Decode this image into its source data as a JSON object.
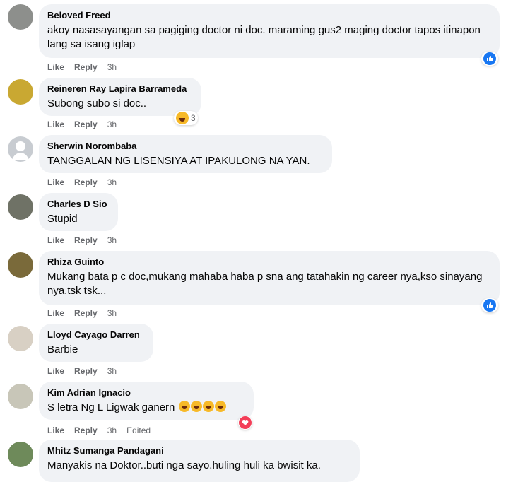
{
  "actions": {
    "like": "Like",
    "reply": "Reply",
    "edited": "Edited"
  },
  "comments": [
    {
      "name": "Beloved Freed",
      "text": "akoy nasasayangan sa pagiging doctor ni doc. maraming gus2 maging doctor tapos itinapon lang sa isang iglap",
      "time": "3h",
      "reaction": "like-icon"
    },
    {
      "name": "Reineren Ray Lapira Barrameda",
      "text": "Subong subo si doc..",
      "time": "3h",
      "reaction": "haha-icon",
      "reaction_count": "3"
    },
    {
      "name": "Sherwin Norombaba",
      "text": "TANGGALAN NG LISENSIYA AT IPAKULONG NA YAN.",
      "time": "3h"
    },
    {
      "name": "Charles D Sio",
      "text": "Stupid",
      "time": "3h"
    },
    {
      "name": "Rhiza Guinto",
      "text": "Mukang bata p c doc,mukang mahaba haba p sna ang tatahakin ng career nya,kso sinayang nya,tsk tsk...",
      "time": "3h",
      "reaction": "like-icon"
    },
    {
      "name": "Lloyd Cayago Darren",
      "text": "Barbie",
      "time": "3h"
    },
    {
      "name": "Kim Adrian Ignacio",
      "text": "S letra Ng L Ligwak ganern",
      "time": "3h",
      "edited": true,
      "reaction": "love-icon",
      "emojis": [
        "rofl-emoji",
        "joy-emoji",
        "rofl-emoji",
        "joy-emoji"
      ]
    },
    {
      "name": "Mhitz Sumanga Pandagani",
      "text": "Manyakis na Doktor..buti nga sayo.huling huli ka bwisit ka.",
      "time": ""
    }
  ]
}
